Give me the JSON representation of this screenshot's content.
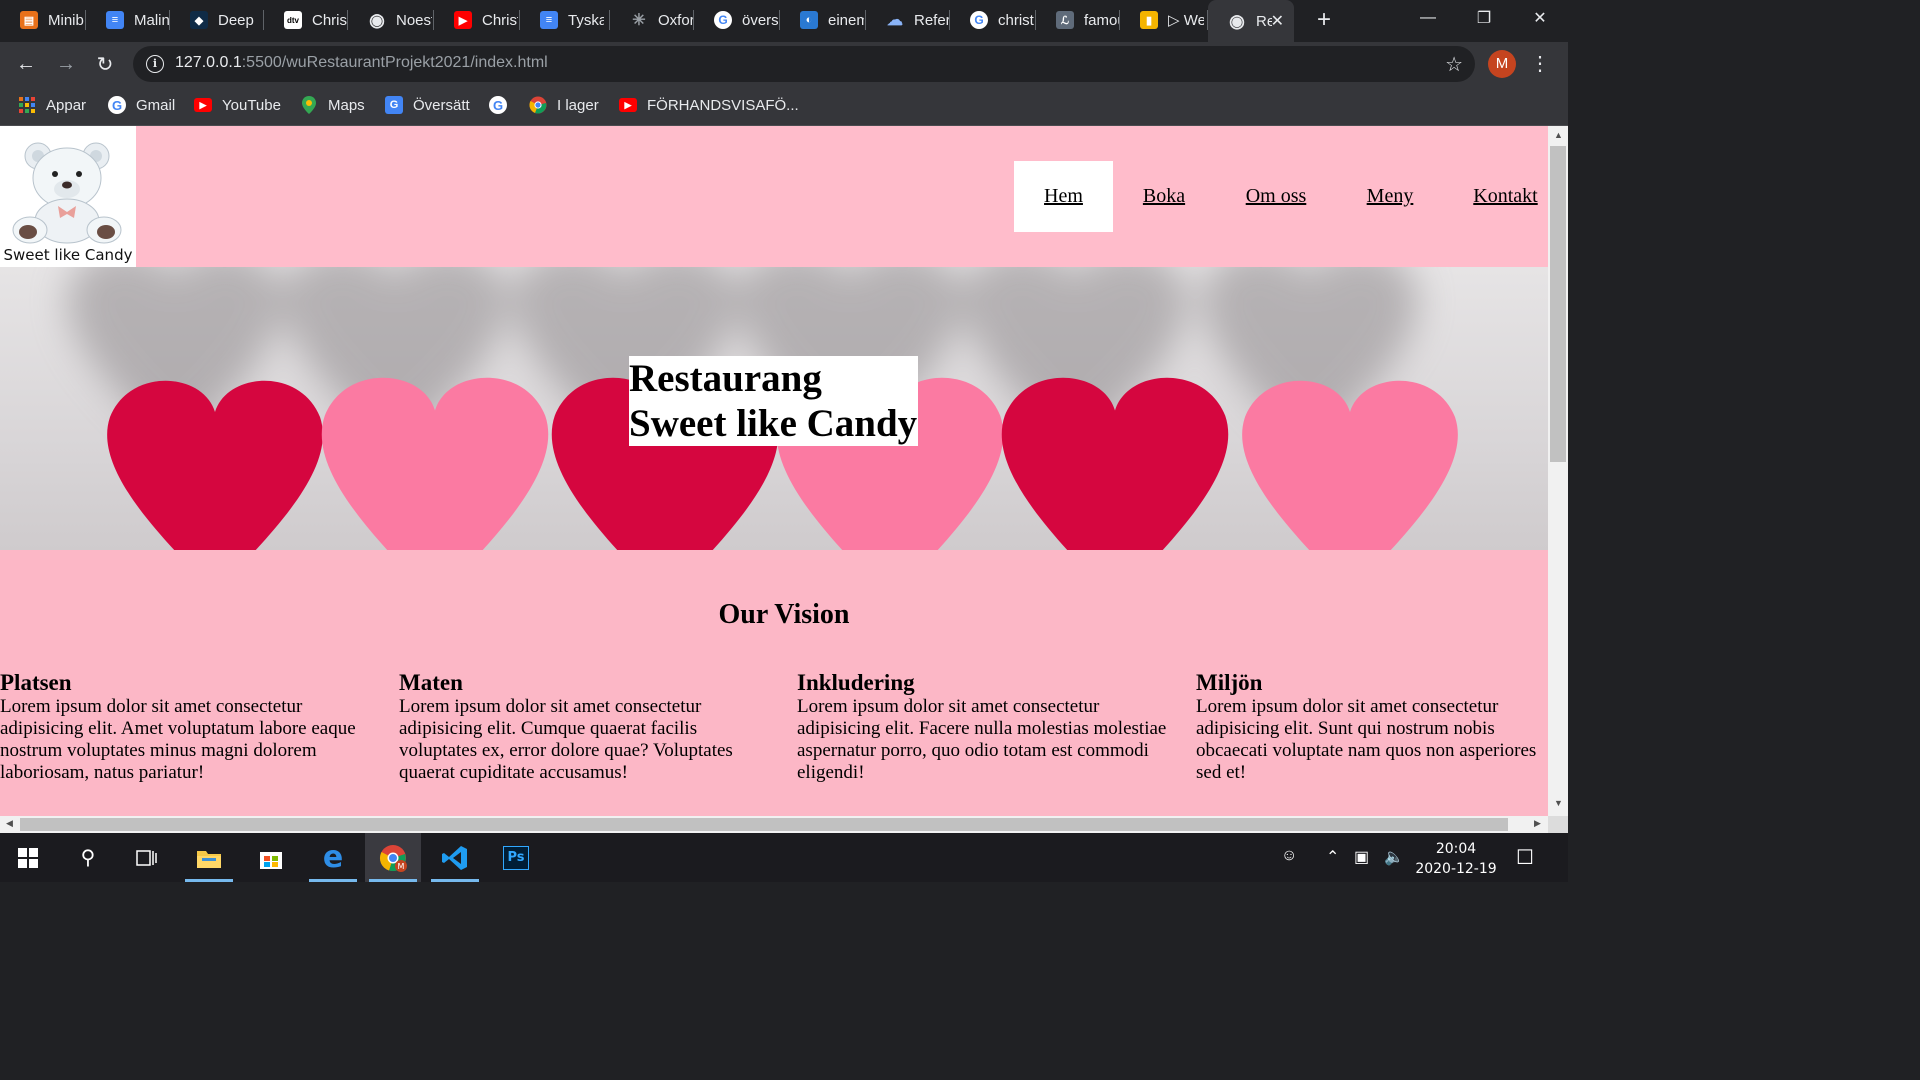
{
  "browser": {
    "tabs": [
      {
        "title": "Minib",
        "icon": "presentation-icon",
        "color": "#e8711a"
      },
      {
        "title": "Malin",
        "icon": "docs-icon",
        "color": "#4285f4"
      },
      {
        "title": "DeepL",
        "icon": "deepl-icon",
        "color": "#0f2b46"
      },
      {
        "title": "Christ",
        "icon": "dtv-icon",
        "color": "#ffffff"
      },
      {
        "title": "Noest",
        "icon": "globe-icon",
        "color": "#ffffff"
      },
      {
        "title": "Christ",
        "icon": "youtube-icon",
        "color": "#ff0000"
      },
      {
        "title": "Tyska",
        "icon": "docs-icon",
        "color": "#4285f4"
      },
      {
        "title": "Oxfor",
        "icon": "sparkle-icon",
        "color": "#9aa0a6"
      },
      {
        "title": "översä",
        "icon": "google-icon",
        "color": "#ffffff"
      },
      {
        "title": "einem",
        "icon": "reverso-icon",
        "color": "#2a79d2"
      },
      {
        "title": "Refer",
        "icon": "cloud-icon",
        "color": "#8ab4f8"
      },
      {
        "title": "christ",
        "icon": "google-icon",
        "color": "#ffffff"
      },
      {
        "title": "famou",
        "icon": "translate-icon",
        "color": "#5f6b7a"
      },
      {
        "title": "▷ We",
        "icon": "slides-icon",
        "color": "#f4b400"
      },
      {
        "title": "Re",
        "icon": "globe-icon",
        "color": "#ffffff",
        "active": true
      }
    ],
    "new_tab_label": "+",
    "url_host": "127.0.0.1",
    "url_path": ":5500/wuRestaurantProjekt2021/index.html",
    "profile_initial": "M",
    "bookmarks": [
      {
        "label": "Appar",
        "icon": "apps-grid-icon"
      },
      {
        "label": "Gmail",
        "icon": "google-icon"
      },
      {
        "label": "YouTube",
        "icon": "youtube-icon"
      },
      {
        "label": "Maps",
        "icon": "maps-pin-icon"
      },
      {
        "label": "Översätt",
        "icon": "translate-icon"
      },
      {
        "label": "",
        "icon": "google-icon"
      },
      {
        "label": "I lager",
        "icon": "chrome-icon"
      },
      {
        "label": "FÖRHANDSVISAFÖ...",
        "icon": "youtube-icon"
      }
    ]
  },
  "site": {
    "logo_caption": "Sweet like Candy",
    "nav": [
      "Hem",
      "Boka",
      "Om oss",
      "Meny",
      "Kontakt"
    ],
    "hero_title_line1": "Restaurang",
    "hero_title_line2": "Sweet like Candy",
    "vision_heading": "Our Vision",
    "columns": [
      {
        "title": "Platsen",
        "text": "Lorem ipsum dolor sit amet consectetur adipisicing elit. Amet voluptatum labore eaque nostrum voluptates minus magni dolorem laboriosam, natus pariatur!"
      },
      {
        "title": "Maten",
        "text": "Lorem ipsum dolor sit amet consectetur adipisicing elit. Cumque quaerat facilis voluptates ex, error dolore quae? Voluptates quaerat cupiditate accusamus!"
      },
      {
        "title": "Inkludering",
        "text": "Lorem ipsum dolor sit amet consectetur adipisicing elit. Facere nulla molestias molestiae aspernatur porro, quo odio totam est commodi eligendi!"
      },
      {
        "title": "Miljön",
        "text": "Lorem ipsum dolor sit amet consectetur adipisicing elit. Sunt qui nostrum nobis obcaecati voluptate nam quos non asperiores sed et!"
      }
    ],
    "colors": {
      "header_bg": "#ffbccb",
      "body_bg": "#fcb7c6",
      "heart_dark": "#d5063f",
      "heart_light": "#fb7aa2"
    }
  },
  "taskbar": {
    "time": "20:04",
    "date": "2020-12-19",
    "apps": [
      "start-icon",
      "search-icon",
      "task-view-icon",
      "file-explorer-icon",
      "store-icon",
      "edge-icon",
      "chrome-icon",
      "vscode-icon",
      "photoshop-icon"
    ]
  }
}
